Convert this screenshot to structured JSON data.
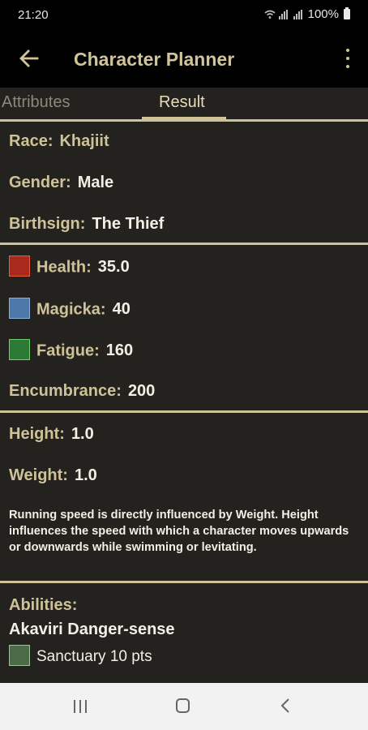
{
  "status_bar": {
    "time": "21:20",
    "battery": "100%"
  },
  "app_bar": {
    "title": "Character Planner",
    "back_icon": "arrow-left-icon",
    "menu_icon": "more-vertical-icon"
  },
  "tabs": [
    {
      "label": "Attributes",
      "selected": false
    },
    {
      "label": "Result",
      "selected": true
    }
  ],
  "profile": {
    "race": {
      "label": "Race:",
      "value": "Khajiit"
    },
    "gender": {
      "label": "Gender:",
      "value": "Male"
    },
    "birthsign": {
      "label": "Birthsign:",
      "value": "The Thief"
    }
  },
  "stats": {
    "health": {
      "label": "Health:",
      "value": "35.0",
      "icon": "health-icon"
    },
    "magicka": {
      "label": "Magicka:",
      "value": "40",
      "icon": "magicka-icon"
    },
    "fatigue": {
      "label": "Fatigue:",
      "value": "160",
      "icon": "fatigue-icon"
    },
    "encumbrance": {
      "label": "Encumbrance:",
      "value": "200"
    }
  },
  "body": {
    "height": {
      "label": "Height:",
      "value": "1.0"
    },
    "weight": {
      "label": "Weight:",
      "value": "1.0"
    },
    "note": "Running speed is directly influenced by Weight. Height influences the speed with which a character moves upwards or downwards while swimming or levitating."
  },
  "abilities": {
    "title": "Abilities:",
    "items": [
      {
        "name": "Akaviri Danger-sense",
        "effect": "Sanctuary 10 pts",
        "icon": "sanctuary-icon"
      }
    ]
  },
  "colors": {
    "accent": "#cfc298",
    "background": "#23221e",
    "text": "#f2efe4",
    "bar": "#000000"
  }
}
